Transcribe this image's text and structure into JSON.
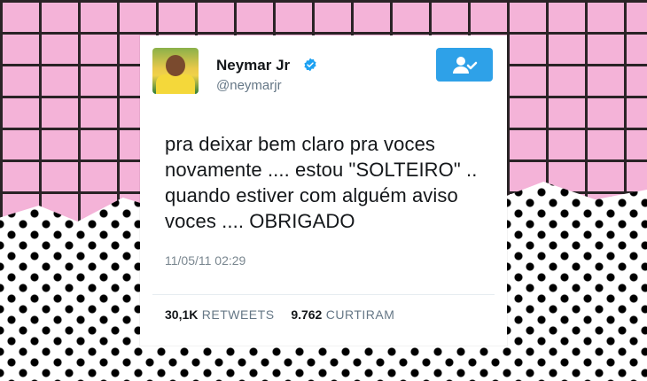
{
  "tweet": {
    "author_name": "Neymar Jr",
    "author_handle": "@neymarjr",
    "text_lines": [
      "pra deixar bem claro pra voces",
      "novamente .... estou \"SOLTEIRO\" ..",
      "quando estiver com alguém aviso",
      "voces .... OBRIGADO"
    ],
    "timestamp": "11/05/11 02:29",
    "retweets_count": "30,1K",
    "retweets_label": "RETWEETS",
    "likes_count": "9.762",
    "likes_label": "CURTIRAM"
  },
  "icons": {
    "verified": "verified-badge-icon",
    "follow": "follow-user-icon"
  },
  "colors": {
    "accent": "#2ea1e8",
    "brick": "#f4b3d8",
    "mortar": "#2a2326"
  }
}
